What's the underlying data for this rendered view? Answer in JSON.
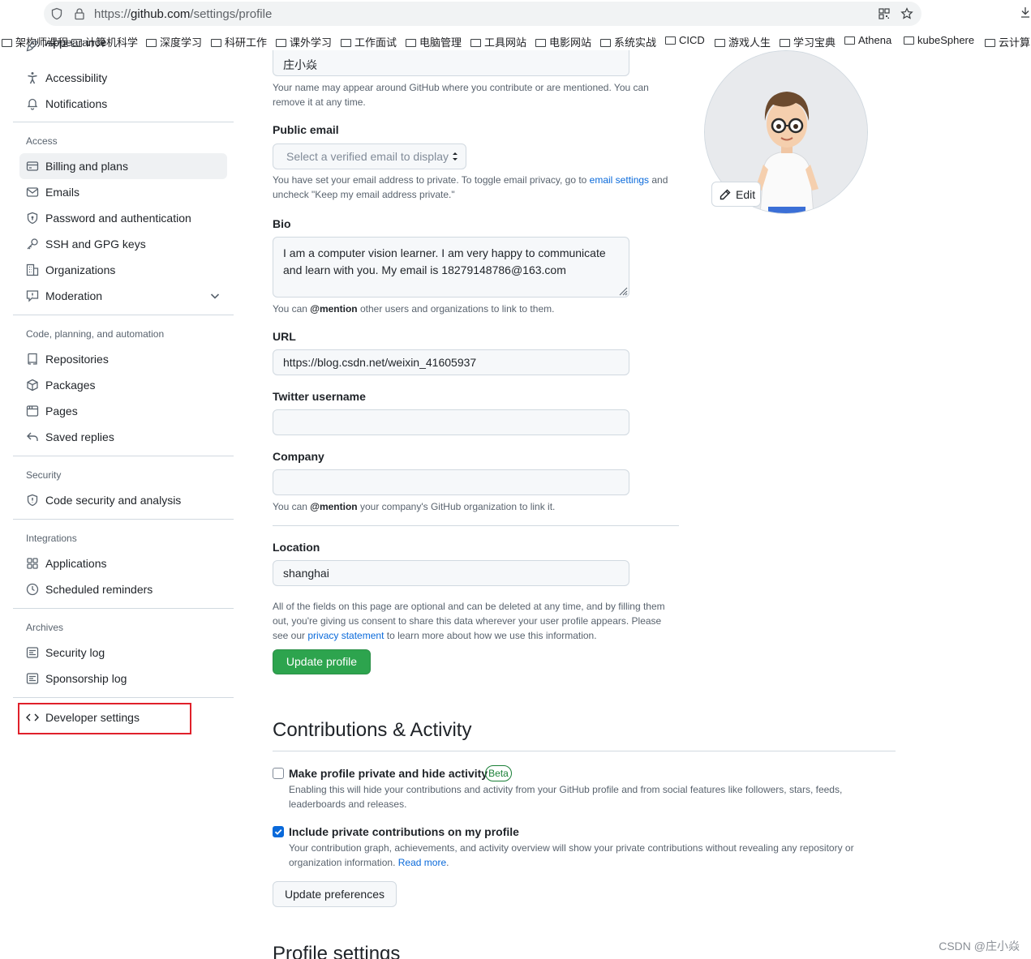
{
  "browser": {
    "url_prefix": "https://",
    "url_domain": "github.com",
    "url_path": "/settings/profile",
    "bookmarks": [
      "架构师课程",
      "计算机科学",
      "深度学习",
      "科研工作",
      "课外学习",
      "工作面试",
      "电脑管理",
      "工具网站",
      "电影网站",
      "系统实战",
      "CICD",
      "游戏人生",
      "学习宝典",
      "Athena",
      "kubeSphere",
      "云计算"
    ]
  },
  "sidebar": {
    "items_top": [
      {
        "label": "Appearance",
        "icon": "paintbrush-icon"
      },
      {
        "label": "Accessibility",
        "icon": "accessibility-icon"
      },
      {
        "label": "Notifications",
        "icon": "bell-icon"
      }
    ],
    "access": {
      "heading": "Access",
      "items": [
        {
          "label": "Billing and plans",
          "icon": "credit-card-icon"
        },
        {
          "label": "Emails",
          "icon": "mail-icon"
        },
        {
          "label": "Password and authentication",
          "icon": "shield-lock-icon"
        },
        {
          "label": "SSH and GPG keys",
          "icon": "key-icon"
        },
        {
          "label": "Organizations",
          "icon": "organization-icon"
        },
        {
          "label": "Moderation",
          "icon": "report-icon"
        }
      ]
    },
    "code": {
      "heading": "Code, planning, and automation",
      "items": [
        {
          "label": "Repositories",
          "icon": "repo-icon"
        },
        {
          "label": "Packages",
          "icon": "package-icon"
        },
        {
          "label": "Pages",
          "icon": "browser-icon"
        },
        {
          "label": "Saved replies",
          "icon": "reply-icon"
        }
      ]
    },
    "security": {
      "heading": "Security",
      "items": [
        {
          "label": "Code security and analysis",
          "icon": "shield-icon"
        }
      ]
    },
    "integrations": {
      "heading": "Integrations",
      "items": [
        {
          "label": "Applications",
          "icon": "apps-icon"
        },
        {
          "label": "Scheduled reminders",
          "icon": "clock-icon"
        }
      ]
    },
    "archives": {
      "heading": "Archives",
      "items": [
        {
          "label": "Security log",
          "icon": "log-icon"
        },
        {
          "label": "Sponsorship log",
          "icon": "log-icon"
        }
      ]
    },
    "developer": {
      "label": "Developer settings",
      "icon": "code-icon"
    }
  },
  "form": {
    "name_value": "庄小焱",
    "name_note": "Your name may appear around GitHub where you contribute or are mentioned. You can remove it at any time.",
    "public_email_label": "Public email",
    "public_email_placeholder": "Select a verified email to display",
    "public_email_note_1": "You have set your email address to private. To toggle email privacy, go to ",
    "public_email_note_link": "email settings",
    "public_email_note_2": " and uncheck \"Keep my email address private.\"",
    "bio_label": "Bio",
    "bio_value": "I am a computer vision learner. I am very happy to communicate and learn with you. My email is 18279148786@163.com",
    "bio_note_1": "You can ",
    "bio_note_mention": "@mention",
    "bio_note_2": " other users and organizations to link to them.",
    "url_label": "URL",
    "url_value": "https://blog.csdn.net/weixin_41605937",
    "twitter_label": "Twitter username",
    "twitter_value": "",
    "company_label": "Company",
    "company_value": "",
    "company_note_1": "You can ",
    "company_note_mention": "@mention",
    "company_note_2": " your company's GitHub organization to link it.",
    "location_label": "Location",
    "location_value": "shanghai",
    "consent_note_1": "All of the fields on this page are optional and can be deleted at any time, and by filling them out, you're giving us consent to share this data wherever your user profile appears. Please see our ",
    "consent_note_link": "privacy statement",
    "consent_note_2": " to learn more about how we use this information.",
    "update_profile_label": "Update profile"
  },
  "avatar": {
    "edit_label": "Edit"
  },
  "contributions": {
    "title": "Contributions & Activity",
    "private_label": "Make profile private and hide activity",
    "private_checked": false,
    "beta_label": "Beta",
    "private_desc": "Enabling this will hide your contributions and activity from your GitHub profile and from social features like followers, stars, feeds, leaderboards and releases.",
    "include_label": "Include private contributions on my profile",
    "include_checked": true,
    "include_desc_1": "Your contribution graph, achievements, and activity overview will show your private contributions without revealing any repository or organization information. ",
    "include_desc_link": "Read more",
    "include_desc_2": ".",
    "update_preferences_label": "Update preferences"
  },
  "profile_settings_title": "Profile settings",
  "watermark": "CSDN @庄小焱",
  "colors": {
    "primary_button": "#2da44e",
    "link": "#0969da",
    "highlight_box": "#e0202a"
  }
}
